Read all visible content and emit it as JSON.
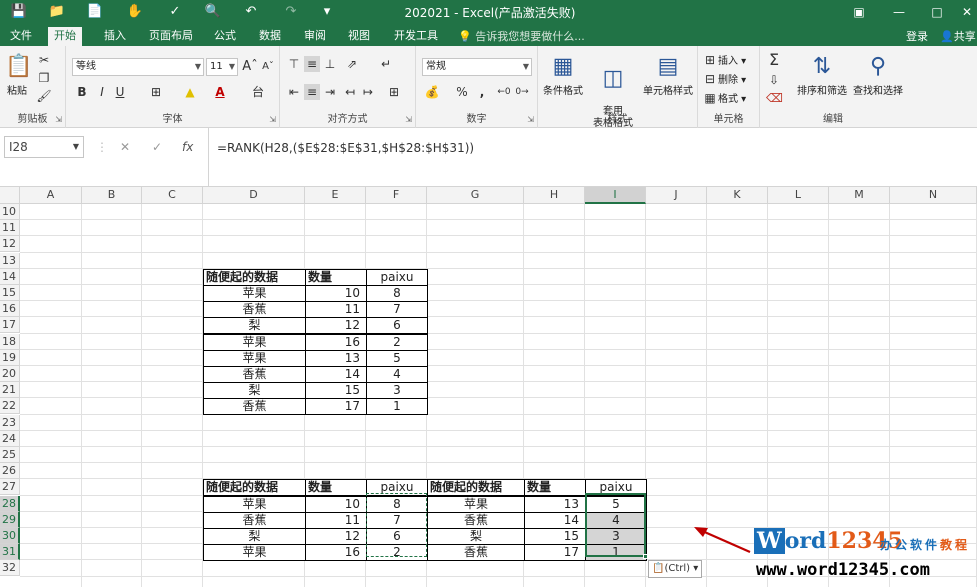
{
  "window": {
    "title": "202021 - Excel(产品激活失败)"
  },
  "tabs": [
    "文件",
    "开始",
    "插入",
    "页面布局",
    "公式",
    "数据",
    "审阅",
    "视图",
    "开发工具"
  ],
  "active_tab": "开始",
  "tell_me": "告诉我您想要做什么...",
  "login": "登录",
  "share": "共享",
  "ribbon": {
    "clipboard": {
      "paste": "粘贴",
      "label": "剪贴板"
    },
    "font": {
      "name": "等线",
      "size": "11",
      "bold": "B",
      "italic": "I",
      "underline": "U",
      "font_color_glyph": "A",
      "label": "字体"
    },
    "alignment": {
      "label": "对齐方式"
    },
    "number": {
      "format": "常规",
      "percent": "%",
      "comma": ",",
      "label": "数字"
    },
    "styles": {
      "conditional": "条件格式",
      "table": "套用\n表格格式",
      "cell": "单元格样式",
      "label": "样式"
    },
    "cells": {
      "insert": "插入",
      "delete": "删除",
      "format": "格式",
      "label": "单元格"
    },
    "editing": {
      "sort": "排序和筛选",
      "find": "查找和选择",
      "sigma": "Σ",
      "label": "编辑"
    }
  },
  "formula_bar": {
    "name_box": "I28",
    "fx": "fx",
    "formula": "=RANK(H28,($E$28:$E$31,$H$28:$H$31))"
  },
  "columns": [
    "A",
    "B",
    "C",
    "D",
    "E",
    "F",
    "G",
    "H",
    "I",
    "J",
    "K",
    "L",
    "M",
    "N"
  ],
  "selected_column": "I",
  "rows": [
    "10",
    "11",
    "12",
    "13",
    "14",
    "15",
    "16",
    "17",
    "18",
    "19",
    "20",
    "21",
    "22",
    "23",
    "24",
    "25",
    "26",
    "27",
    "28",
    "29",
    "30",
    "31",
    "32"
  ],
  "selected_rows": [
    "28",
    "29",
    "30",
    "31"
  ],
  "table1": {
    "headers": [
      "随便起的数据",
      "数量",
      "paixu"
    ],
    "rows": [
      [
        "苹果",
        "10",
        "8"
      ],
      [
        "香蕉",
        "11",
        "7"
      ],
      [
        "梨",
        "12",
        "6"
      ],
      [
        "苹果",
        "16",
        "2"
      ],
      [
        "苹果",
        "13",
        "5"
      ],
      [
        "香蕉",
        "14",
        "4"
      ],
      [
        "梨",
        "15",
        "3"
      ],
      [
        "香蕉",
        "17",
        "1"
      ]
    ]
  },
  "table2": {
    "headers": [
      "随便起的数据",
      "数量",
      "paixu",
      "随便起的数据",
      "数量",
      "paixu"
    ],
    "rows": [
      [
        "苹果",
        "10",
        "8",
        "苹果",
        "13",
        "5"
      ],
      [
        "香蕉",
        "11",
        "7",
        "香蕉",
        "14",
        "4"
      ],
      [
        "梨",
        "12",
        "6",
        "梨",
        "15",
        "3"
      ],
      [
        "苹果",
        "16",
        "2",
        "香蕉",
        "17",
        "1"
      ]
    ]
  },
  "paste_options": "(Ctrl)",
  "watermark": {
    "w": "W",
    "ord": "ord",
    "num": "12345",
    "cn1": "办公软件",
    "cn2": "教程",
    "url": "www.word12345.com"
  },
  "colors": {
    "accent": "#217346",
    "selection_fill": "#d5d5d5",
    "arrow": "#c00000"
  }
}
